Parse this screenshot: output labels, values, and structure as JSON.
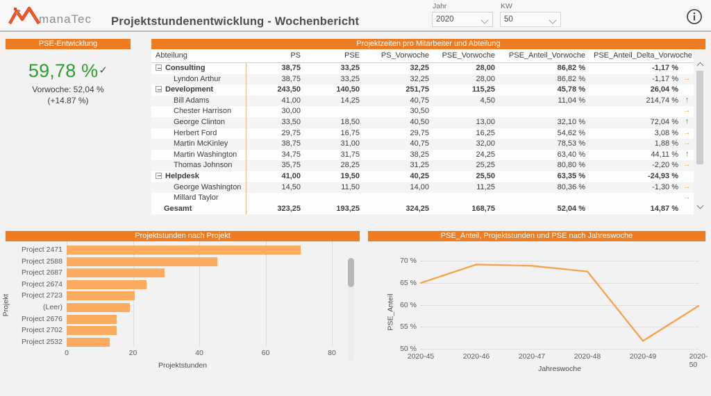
{
  "header": {
    "logo_text": "manaTec",
    "title": "Projektstundenentwicklung - Wochenbericht",
    "filters": [
      {
        "label": "Jahr",
        "value": "2020",
        "name": "jahr"
      },
      {
        "label": "KW",
        "value": "50",
        "name": "kw"
      }
    ],
    "info_icon": "info-icon"
  },
  "kpi": {
    "title": "PSE-Entwicklung",
    "value": "59,78 %",
    "trend_icon": "check-icon",
    "previous": "Vorwoche: 52,04 %",
    "delta": "(+14.87 %)",
    "value_color": "#2ca02c"
  },
  "table": {
    "title": "Projektzeiten pro Mitarbeiter und Abteilung",
    "columns": [
      "Abteilung",
      "PS",
      "PSE",
      "PS_Vorwoche",
      "PSE_Vorwoche",
      "PSE_Anteil_Vorwoche",
      "PSE_Anteil_Delta_Vorwoche"
    ],
    "rows": [
      {
        "type": "group",
        "name": "Consulting",
        "ps": "38,75",
        "pse": "33,25",
        "ps_vw": "32,25",
        "pse_vw": "28,00",
        "anteil_vw": "86,82 %",
        "delta_vw": "-1,17 %",
        "arrow": ""
      },
      {
        "type": "member",
        "name": "Lyndon Arthur",
        "ps": "38,75",
        "pse": "33,25",
        "ps_vw": "32,25",
        "pse_vw": "28,00",
        "anteil_vw": "86,82 %",
        "delta_vw": "-1,17 %",
        "arrow": "flat"
      },
      {
        "type": "group",
        "name": "Development",
        "ps": "243,50",
        "pse": "140,50",
        "ps_vw": "251,75",
        "pse_vw": "115,25",
        "anteil_vw": "45,78 %",
        "delta_vw": "26,04 %",
        "arrow": ""
      },
      {
        "type": "member",
        "name": "Bill Adams",
        "ps": "41,00",
        "pse": "14,25",
        "ps_vw": "40,75",
        "pse_vw": "4,50",
        "anteil_vw": "11,04 %",
        "delta_vw": "214,74 %",
        "arrow": "up"
      },
      {
        "type": "member",
        "name": "Chester Harrison",
        "ps": "30,00",
        "pse": "",
        "ps_vw": "30,50",
        "pse_vw": "",
        "anteil_vw": "",
        "delta_vw": "",
        "arrow": "flat"
      },
      {
        "type": "member",
        "name": "George Clinton",
        "ps": "33,50",
        "pse": "18,50",
        "ps_vw": "40,50",
        "pse_vw": "13,00",
        "anteil_vw": "32,10 %",
        "delta_vw": "72,04 %",
        "arrow": "up"
      },
      {
        "type": "member",
        "name": "Herbert Ford",
        "ps": "29,75",
        "pse": "16,75",
        "ps_vw": "29,75",
        "pse_vw": "16,25",
        "anteil_vw": "54,62 %",
        "delta_vw": "3,08 %",
        "arrow": "flat"
      },
      {
        "type": "member",
        "name": "Martin McKinley",
        "ps": "38,75",
        "pse": "31,00",
        "ps_vw": "40,75",
        "pse_vw": "32,00",
        "anteil_vw": "78,53 %",
        "delta_vw": "1,88 %",
        "arrow": "flat"
      },
      {
        "type": "member",
        "name": "Martin Washington",
        "ps": "34,75",
        "pse": "31,75",
        "ps_vw": "38,25",
        "pse_vw": "24,25",
        "anteil_vw": "63,40 %",
        "delta_vw": "44,11 %",
        "arrow": "up"
      },
      {
        "type": "member",
        "name": "Thomas Johnson",
        "ps": "35,75",
        "pse": "28,25",
        "ps_vw": "31,25",
        "pse_vw": "25,25",
        "anteil_vw": "80,80 %",
        "delta_vw": "-2,20 %",
        "arrow": "flat"
      },
      {
        "type": "group",
        "name": "Helpdesk",
        "ps": "41,00",
        "pse": "19,50",
        "ps_vw": "40,25",
        "pse_vw": "25,50",
        "anteil_vw": "63,35 %",
        "delta_vw": "-24,93 %",
        "arrow": ""
      },
      {
        "type": "member",
        "name": "George Washington",
        "ps": "14,50",
        "pse": "11,50",
        "ps_vw": "14,00",
        "pse_vw": "11,25",
        "anteil_vw": "80,36 %",
        "delta_vw": "-1,30 %",
        "arrow": "flat"
      },
      {
        "type": "member",
        "name": "Millard Taylor",
        "ps": "",
        "pse": "",
        "ps_vw": "",
        "pse_vw": "",
        "anteil_vw": "",
        "delta_vw": "",
        "arrow": "flat"
      },
      {
        "type": "total",
        "name": "Gesamt",
        "ps": "323,25",
        "pse": "193,25",
        "ps_vw": "324,25",
        "pse_vw": "168,75",
        "anteil_vw": "52,04 %",
        "delta_vw": "14,87 %",
        "arrow": ""
      }
    ]
  },
  "chart_data": [
    {
      "type": "bar",
      "orientation": "horizontal",
      "title": "Projektstunden nach Projekt",
      "xlabel": "Projektstunden",
      "ylabel": "Projekt",
      "xlim": [
        0,
        80
      ],
      "xticks": [
        0,
        20,
        40,
        60,
        80
      ],
      "grid": true,
      "color": "#fbab60",
      "categories": [
        "Project 2471",
        "Project 2588",
        "Project 2687",
        "Project 2674",
        "Project 2723",
        "(Leer)",
        "Project 2676",
        "Project 2702",
        "Project 2532"
      ],
      "values": [
        70.5,
        45.5,
        29.5,
        24.0,
        20.5,
        19.0,
        15.0,
        15.0,
        13.0
      ]
    },
    {
      "type": "line",
      "title": "PSE_Anteil, Projektstunden und PSE nach Jahreswoche",
      "xlabel": "Jahreswoche",
      "ylabel": "PSE_Anteil",
      "ylim": [
        50,
        71
      ],
      "yticks": [
        "50 %",
        "55 %",
        "60 %",
        "65 %",
        "70 %"
      ],
      "ytick_values": [
        50,
        55,
        60,
        65,
        70
      ],
      "grid": true,
      "color": "#f6a24a",
      "categories": [
        "2020-45",
        "2020-46",
        "2020-47",
        "2020-48",
        "2020-49",
        "2020-50"
      ],
      "values": [
        65.0,
        69.2,
        68.9,
        67.6,
        51.8,
        59.78
      ]
    }
  ]
}
